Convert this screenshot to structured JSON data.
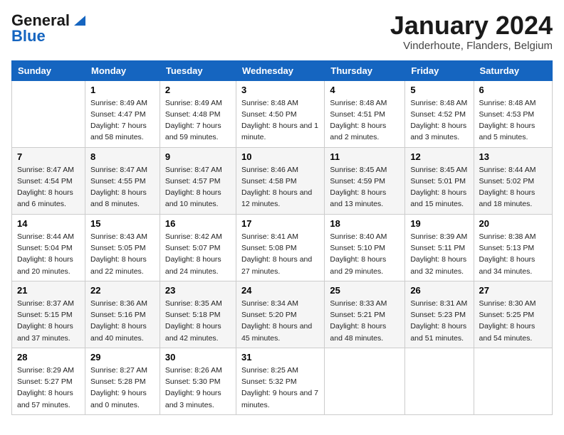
{
  "header": {
    "logo_line1": "General",
    "logo_line2": "Blue",
    "month_title": "January 2024",
    "subtitle": "Vinderhoute, Flanders, Belgium"
  },
  "days_of_week": [
    "Sunday",
    "Monday",
    "Tuesday",
    "Wednesday",
    "Thursday",
    "Friday",
    "Saturday"
  ],
  "weeks": [
    [
      {
        "day": "",
        "info": ""
      },
      {
        "day": "1",
        "info": "Sunrise: 8:49 AM\nSunset: 4:47 PM\nDaylight: 7 hours\nand 58 minutes."
      },
      {
        "day": "2",
        "info": "Sunrise: 8:49 AM\nSunset: 4:48 PM\nDaylight: 7 hours\nand 59 minutes."
      },
      {
        "day": "3",
        "info": "Sunrise: 8:48 AM\nSunset: 4:50 PM\nDaylight: 8 hours\nand 1 minute."
      },
      {
        "day": "4",
        "info": "Sunrise: 8:48 AM\nSunset: 4:51 PM\nDaylight: 8 hours\nand 2 minutes."
      },
      {
        "day": "5",
        "info": "Sunrise: 8:48 AM\nSunset: 4:52 PM\nDaylight: 8 hours\nand 3 minutes."
      },
      {
        "day": "6",
        "info": "Sunrise: 8:48 AM\nSunset: 4:53 PM\nDaylight: 8 hours\nand 5 minutes."
      }
    ],
    [
      {
        "day": "7",
        "info": "Sunrise: 8:47 AM\nSunset: 4:54 PM\nDaylight: 8 hours\nand 6 minutes."
      },
      {
        "day": "8",
        "info": "Sunrise: 8:47 AM\nSunset: 4:55 PM\nDaylight: 8 hours\nand 8 minutes."
      },
      {
        "day": "9",
        "info": "Sunrise: 8:47 AM\nSunset: 4:57 PM\nDaylight: 8 hours\nand 10 minutes."
      },
      {
        "day": "10",
        "info": "Sunrise: 8:46 AM\nSunset: 4:58 PM\nDaylight: 8 hours\nand 12 minutes."
      },
      {
        "day": "11",
        "info": "Sunrise: 8:45 AM\nSunset: 4:59 PM\nDaylight: 8 hours\nand 13 minutes."
      },
      {
        "day": "12",
        "info": "Sunrise: 8:45 AM\nSunset: 5:01 PM\nDaylight: 8 hours\nand 15 minutes."
      },
      {
        "day": "13",
        "info": "Sunrise: 8:44 AM\nSunset: 5:02 PM\nDaylight: 8 hours\nand 18 minutes."
      }
    ],
    [
      {
        "day": "14",
        "info": "Sunrise: 8:44 AM\nSunset: 5:04 PM\nDaylight: 8 hours\nand 20 minutes."
      },
      {
        "day": "15",
        "info": "Sunrise: 8:43 AM\nSunset: 5:05 PM\nDaylight: 8 hours\nand 22 minutes."
      },
      {
        "day": "16",
        "info": "Sunrise: 8:42 AM\nSunset: 5:07 PM\nDaylight: 8 hours\nand 24 minutes."
      },
      {
        "day": "17",
        "info": "Sunrise: 8:41 AM\nSunset: 5:08 PM\nDaylight: 8 hours\nand 27 minutes."
      },
      {
        "day": "18",
        "info": "Sunrise: 8:40 AM\nSunset: 5:10 PM\nDaylight: 8 hours\nand 29 minutes."
      },
      {
        "day": "19",
        "info": "Sunrise: 8:39 AM\nSunset: 5:11 PM\nDaylight: 8 hours\nand 32 minutes."
      },
      {
        "day": "20",
        "info": "Sunrise: 8:38 AM\nSunset: 5:13 PM\nDaylight: 8 hours\nand 34 minutes."
      }
    ],
    [
      {
        "day": "21",
        "info": "Sunrise: 8:37 AM\nSunset: 5:15 PM\nDaylight: 8 hours\nand 37 minutes."
      },
      {
        "day": "22",
        "info": "Sunrise: 8:36 AM\nSunset: 5:16 PM\nDaylight: 8 hours\nand 40 minutes."
      },
      {
        "day": "23",
        "info": "Sunrise: 8:35 AM\nSunset: 5:18 PM\nDaylight: 8 hours\nand 42 minutes."
      },
      {
        "day": "24",
        "info": "Sunrise: 8:34 AM\nSunset: 5:20 PM\nDaylight: 8 hours\nand 45 minutes."
      },
      {
        "day": "25",
        "info": "Sunrise: 8:33 AM\nSunset: 5:21 PM\nDaylight: 8 hours\nand 48 minutes."
      },
      {
        "day": "26",
        "info": "Sunrise: 8:31 AM\nSunset: 5:23 PM\nDaylight: 8 hours\nand 51 minutes."
      },
      {
        "day": "27",
        "info": "Sunrise: 8:30 AM\nSunset: 5:25 PM\nDaylight: 8 hours\nand 54 minutes."
      }
    ],
    [
      {
        "day": "28",
        "info": "Sunrise: 8:29 AM\nSunset: 5:27 PM\nDaylight: 8 hours\nand 57 minutes."
      },
      {
        "day": "29",
        "info": "Sunrise: 8:27 AM\nSunset: 5:28 PM\nDaylight: 9 hours\nand 0 minutes."
      },
      {
        "day": "30",
        "info": "Sunrise: 8:26 AM\nSunset: 5:30 PM\nDaylight: 9 hours\nand 3 minutes."
      },
      {
        "day": "31",
        "info": "Sunrise: 8:25 AM\nSunset: 5:32 PM\nDaylight: 9 hours\nand 7 minutes."
      },
      {
        "day": "",
        "info": ""
      },
      {
        "day": "",
        "info": ""
      },
      {
        "day": "",
        "info": ""
      }
    ]
  ]
}
